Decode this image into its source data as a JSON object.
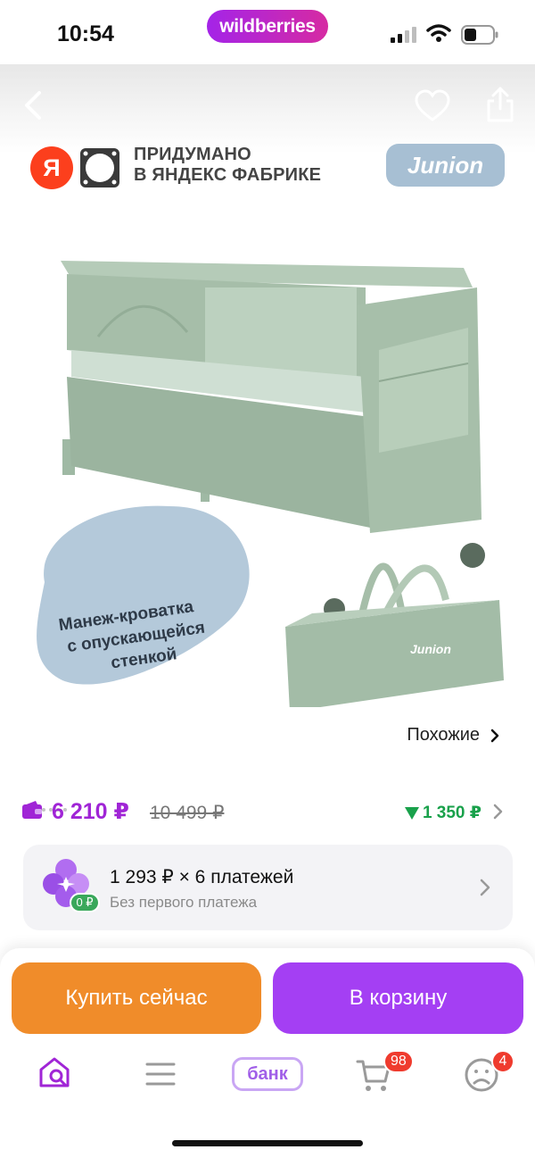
{
  "status_bar": {
    "time": "10:54",
    "brand": "wildberries"
  },
  "gallery": {
    "factory_line1": "ПРИДУМАНО",
    "factory_line2": "В ЯНДЕКС ФАБРИКЕ",
    "yandex_letter": "Я",
    "brand_logo": "Junion",
    "bubble_line1": "Манеж-кроватка",
    "bubble_line2": "с опускающейся",
    "bubble_line3": "стенкой",
    "bag_logo": "Junion",
    "crib_logo": "Junion",
    "similar_label": "Похожие",
    "slides": 5,
    "active_slide": 1
  },
  "price": {
    "current": "6 210 ₽",
    "old": "10 499 ₽",
    "discount": "1 350 ₽"
  },
  "installment": {
    "title": "1 293 ₽ × 6 платежей",
    "subtitle": "Без первого платежа",
    "zero_badge": "0 ₽"
  },
  "actions": {
    "buy_now": "Купить сейчас",
    "add_to_cart": "В корзину"
  },
  "tabbar": {
    "bank_label": "банк",
    "cart_badge": "98",
    "profile_badge": "4"
  },
  "colors": {
    "accent": "#a43ff3",
    "buy_button": "#f08c2a",
    "price": "#a025d6",
    "discount": "#19a14b",
    "badge": "#ef3b2e",
    "crib": "#a9c2ae"
  }
}
